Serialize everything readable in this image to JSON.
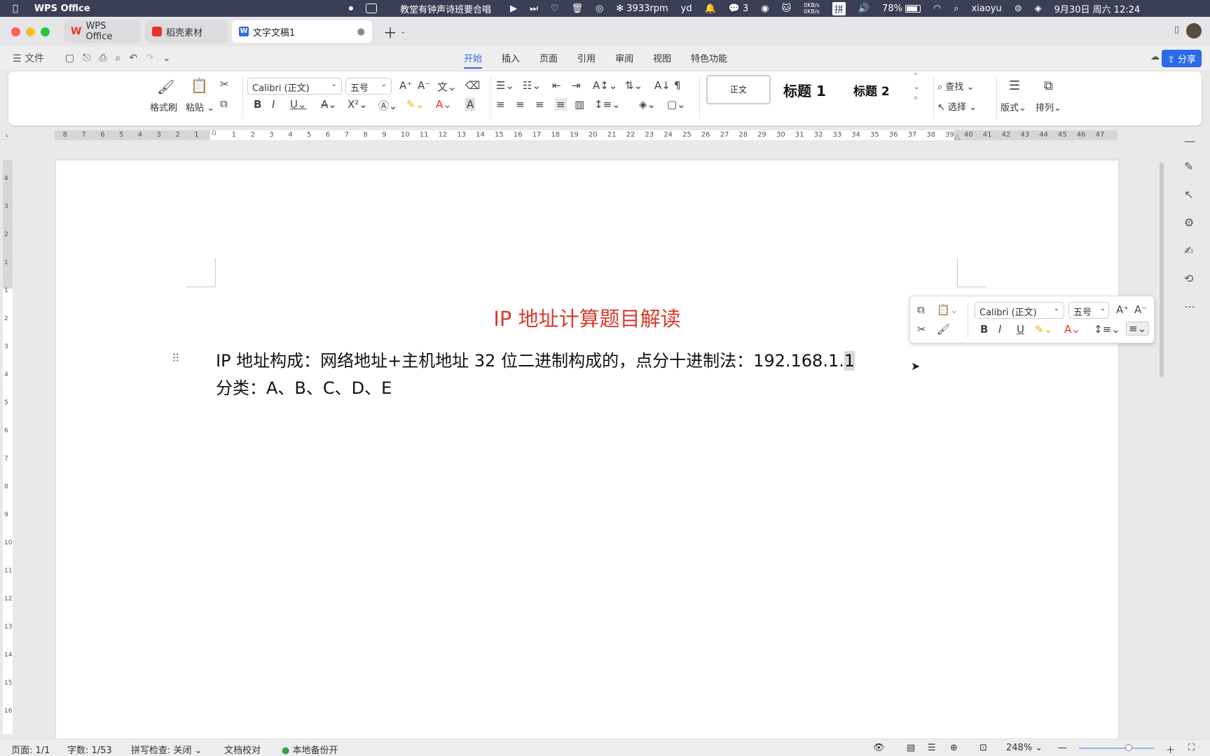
{
  "menubar": {
    "app_name": "WPS Office",
    "now_playing": "教堂有钟声诗班要合唱",
    "fan": "3933rpm",
    "notifications_count": "3",
    "net_up": "0KB/s",
    "net_down": "0KB/s",
    "ime": "拼",
    "battery": "78%",
    "user": "xiaoyu",
    "datetime": "9月30日 周六  12:24"
  },
  "tabs": [
    {
      "label": "WPS Office"
    },
    {
      "label": "稻壳素材"
    },
    {
      "label": "文字文稿1"
    }
  ],
  "menu": {
    "file": "文件",
    "items": [
      "开始",
      "插入",
      "页面",
      "引用",
      "审阅",
      "视图",
      "特色功能"
    ],
    "share": "分享"
  },
  "ribbon": {
    "format_painter": "格式刷",
    "paste": "粘贴",
    "font_name": "Calibri (正文)",
    "font_size": "五号",
    "style_normal": "正文",
    "style_h1": "标题 1",
    "style_h2": "标题 2",
    "find": "查找",
    "select": "选择",
    "layout": "版式",
    "arrange": "排列"
  },
  "ruler": {
    "left_ticks": [
      "8",
      "7",
      "6",
      "5",
      "4",
      "3",
      "2",
      "1"
    ],
    "right_ticks": [
      "1",
      "2",
      "3",
      "4",
      "5",
      "6",
      "7",
      "8",
      "9",
      "10",
      "11",
      "12",
      "13",
      "14",
      "15",
      "16",
      "17",
      "18",
      "19",
      "20",
      "21",
      "22",
      "23",
      "24",
      "25",
      "26",
      "27",
      "28",
      "29",
      "30",
      "31",
      "32",
      "33",
      "34",
      "35",
      "36",
      "37",
      "38",
      "39",
      "40",
      "41",
      "42",
      "43",
      "44",
      "45",
      "46",
      "47"
    ]
  },
  "vruler_ticks": [
    "4",
    "3",
    "2",
    "1",
    "1",
    "2",
    "3",
    "4",
    "5",
    "6",
    "7",
    "8",
    "9",
    "10",
    "11",
    "12",
    "13",
    "14",
    "15",
    "16"
  ],
  "document": {
    "title": "IP 地址计算题目解读",
    "line1_main": "IP 地址构成：网络地址+主机地址   32 位二进制构成的，点分十进制法：192.168.1.",
    "line1_sel": "1",
    "line2": "分类：A、B、C、D、E"
  },
  "floatbar": {
    "font_name": "Calibri (正文)",
    "font_size": "五号"
  },
  "status": {
    "page": "页面: 1/1",
    "words": "字数: 1/53",
    "spell": "拼写检查: 关闭",
    "proof": "文档校对",
    "backup": "本地备份开",
    "zoom": "248%"
  },
  "colors": {
    "accent": "#2b6bea",
    "title_red": "#d93a2b",
    "menubar_bg": "#3a3f55"
  }
}
